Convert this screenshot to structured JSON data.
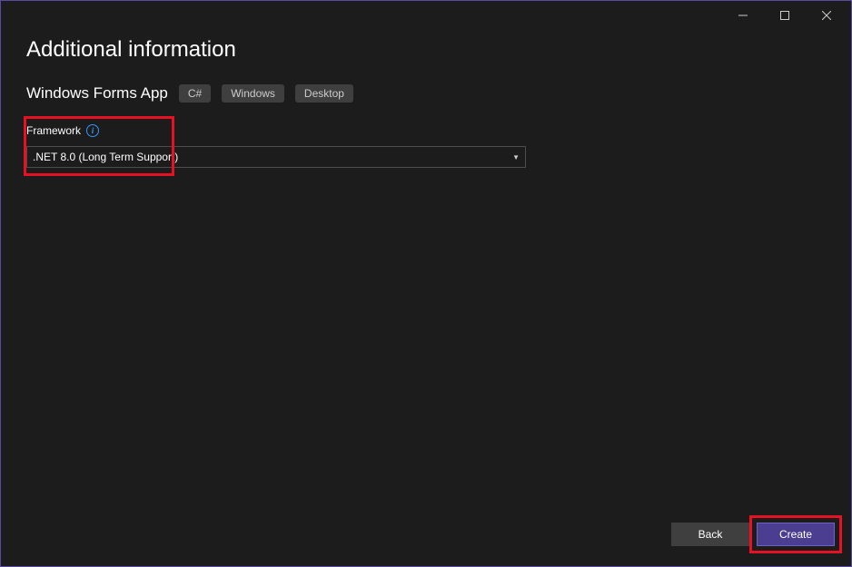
{
  "titlebar": {
    "minimize": "minimize",
    "maximize": "maximize",
    "close": "close"
  },
  "page": {
    "title": "Additional information",
    "subtitle": "Windows Forms App"
  },
  "tags": [
    "C#",
    "Windows",
    "Desktop"
  ],
  "framework": {
    "label": "Framework",
    "selected": ".NET 8.0 (Long Term Support)"
  },
  "buttons": {
    "back": "Back",
    "create": "Create"
  }
}
